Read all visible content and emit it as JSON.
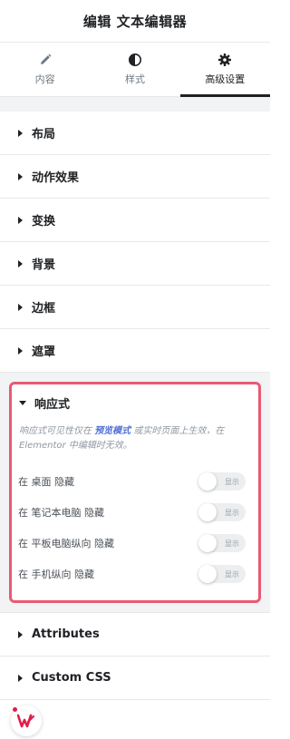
{
  "header": {
    "title": "编辑 文本编辑器"
  },
  "tabs": [
    {
      "label": "内容",
      "icon": "pencil-icon",
      "active": false
    },
    {
      "label": "样式",
      "icon": "contrast-icon",
      "active": false
    },
    {
      "label": "高级设置",
      "icon": "gear-icon",
      "active": true
    }
  ],
  "sections": [
    {
      "label": "布局"
    },
    {
      "label": "动作效果"
    },
    {
      "label": "变换"
    },
    {
      "label": "背景"
    },
    {
      "label": "边框"
    },
    {
      "label": "遮罩"
    }
  ],
  "responsive": {
    "label": "响应式",
    "note_prefix": "响应式可见性仅在 ",
    "note_link": "预览模式",
    "note_suffix": " 或实时页面上生效，在 Elementor 中编辑时无效。",
    "rows": [
      {
        "label": "在 桌面 隐藏",
        "toggle": "显示"
      },
      {
        "label": "在 笔记本电脑 隐藏",
        "toggle": "显示"
      },
      {
        "label": "在 平板电脑纵向 隐藏",
        "toggle": "显示"
      },
      {
        "label": "在 手机纵向 隐藏",
        "toggle": "显示"
      }
    ]
  },
  "bottom_sections": [
    {
      "label": "Attributes"
    },
    {
      "label": "Custom CSS"
    }
  ],
  "colors": {
    "highlight_border": "#e95a72",
    "link": "#4f6fd6",
    "badge": "#e11d48"
  }
}
